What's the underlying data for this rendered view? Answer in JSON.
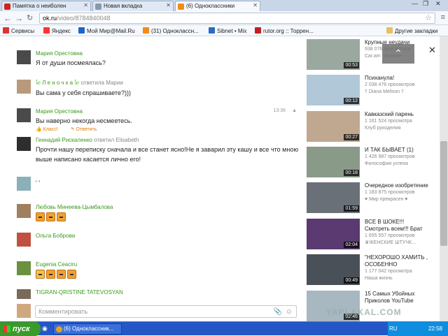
{
  "browser": {
    "tabs": [
      {
        "label": "Памятка о неиболен",
        "color": "#c8261e"
      },
      {
        "label": "Новая вкладка",
        "color": "#8899aa"
      },
      {
        "label": "(6) Одноклассники",
        "color": "#f28a1d"
      }
    ],
    "url_host": "ok.ru",
    "url_path": "/video/8784840048",
    "bookmarks": [
      {
        "label": "Сервисы",
        "color": "#d33"
      },
      {
        "label": "Яндекс",
        "color": "#f33"
      },
      {
        "label": "Мой Мир@Mail.Ru",
        "color": "#1e64c8"
      },
      {
        "label": "(31) Одноклассн...",
        "color": "#f28a1d"
      },
      {
        "label": "Sibnet • Mix",
        "color": "#2a6cc0"
      },
      {
        "label": "rutor.org :: Торрен...",
        "color": "#c02020"
      }
    ],
    "other_bookmarks": "Другие закладки"
  },
  "comments": [
    {
      "author": "Мария Орестовна",
      "reply_to": "",
      "text": "Я от души посмеялась?",
      "time": ""
    },
    {
      "author": "ﭑ℮ Л е н о ч к а ﭑ℮",
      "reply_to": "ответила Марии",
      "text": "Вы сама у себя спрашиваете?)))",
      "time": ""
    },
    {
      "author": "Мария Орестовна",
      "reply_to": "",
      "text": "Вы наверно некогда несмеетесь.",
      "time": "13:36"
    },
    {
      "author": "Геннадий Рискаленко",
      "reply_to": "ответил Elisabeth",
      "text": "Прочти нашу переписку сначала и все станет ясно!Не я заварил эту кашу и все что мною выше написано касается лично его!",
      "time": ""
    },
    {
      "author": "",
      "reply_to": "",
      "text": "' '",
      "time": ""
    },
    {
      "author": "Любовь Минеева-Цымбалова",
      "reply_to": "",
      "text": "",
      "time": ""
    },
    {
      "author": "Ольга Боброва",
      "reply_to": "",
      "text": "",
      "time": ""
    },
    {
      "author": "Eugenia Ceaciru",
      "reply_to": "",
      "text": "",
      "time": ""
    },
    {
      "author": "TIGRAN-QRISTINE TATEVOSYAN",
      "reply_to": "",
      "text": "",
      "time": ""
    }
  ],
  "comment_actions": {
    "like": "Класс!",
    "reply": "Ответить"
  },
  "comment_placeholder": "Комментировать",
  "videos": [
    {
      "title": "Крупные неудачи",
      "views": "938 076 просмотров",
      "channel": "Car.am ~Ереван",
      "duration": "00:53"
    },
    {
      "title": "Психанула!",
      "views": "2 038 476 просмотров",
      "channel": "† Diana Melison †",
      "duration": "00:12"
    },
    {
      "title": "Кавказский парень",
      "views": "1 161 524 просмотра",
      "channel": "Клуб рукоделия",
      "duration": "00:27"
    },
    {
      "title": "И ТАК БЫВАЕТ (1)",
      "views": "1 426 987 просмотров",
      "channel": "Философия успеха",
      "duration": "00:18"
    },
    {
      "title": "Очередное изобретение",
      "views": "1 183 875 просмотров",
      "channel": "♥ Мир прекрасен ♥",
      "duration": "01:59"
    },
    {
      "title": "ВСЕ В ШОКЕ!!! Смотреть всем!!! Брат",
      "views": "1 655 557 просмотров",
      "channel": "♛ЖЕНСКИЕ ШТУЧК...",
      "duration": "02:04"
    },
    {
      "title": "\"НЕХОРОШО ХАМИТЬ , ОСОБЕННО",
      "views": "1 177 042 просмотра",
      "channel": "Наша жизнь",
      "duration": "00:49"
    },
    {
      "title": "15 Самых Убойных Приколов YouTube",
      "views": "",
      "channel": "",
      "duration": "02:46"
    }
  ],
  "taskbar": {
    "start": "пуск",
    "task": "(6) Одноклассник...",
    "lang": "RU",
    "clock": "22:58"
  },
  "watermark": "YAPLAKAL.COM"
}
